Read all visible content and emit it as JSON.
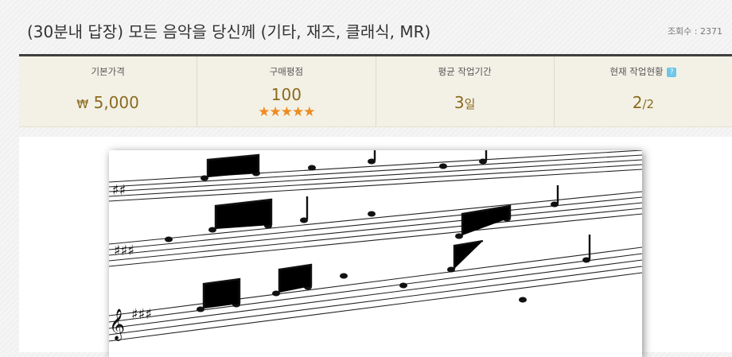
{
  "header": {
    "title": "(30분내 답장) 모든 음악을 당신께 (기타, 재즈, 클래식, MR)",
    "views_label": "조회수 : 2371"
  },
  "stats": {
    "price": {
      "label": "기본가격",
      "currency": "₩",
      "value": "5,000"
    },
    "rating": {
      "label": "구매평점",
      "value": "100",
      "stars": 5,
      "stars_text": "★★★★★"
    },
    "duration": {
      "label": "평균 작업기간",
      "value": "3",
      "unit": "일"
    },
    "workload": {
      "label": "현재 작업현황",
      "help_icon": "?",
      "value": "2",
      "total": "/2"
    }
  },
  "colors": {
    "accent": "#8c6a1f",
    "star": "#ee8b22",
    "help": "#6fc6e8",
    "stats_bg": "#f3f1e6"
  },
  "image": {
    "subject": "sheet-music-icon"
  }
}
